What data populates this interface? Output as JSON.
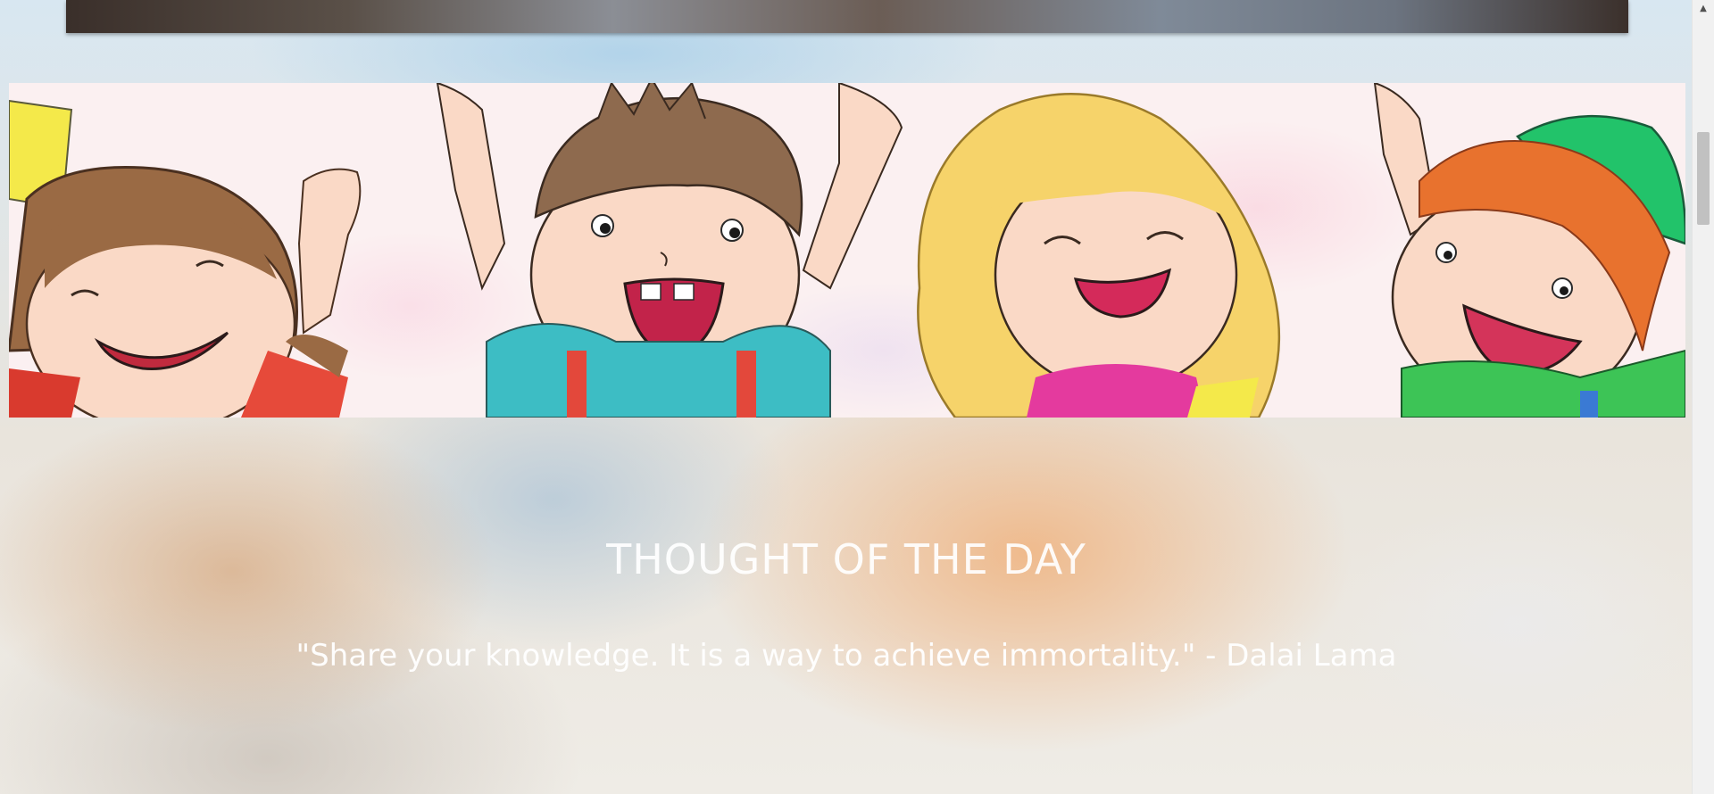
{
  "thought": {
    "title": "THOUGHT OF THE DAY",
    "quote": "\"Share your knowledge. It is a way to achieve immortality.\" - Dalai Lama"
  },
  "colors": {
    "title_text": "#ffffff",
    "quote_text": "#ffffff",
    "banner_background": "#fbf0f1"
  },
  "icons": {
    "scroll_up": "triangle-up"
  }
}
